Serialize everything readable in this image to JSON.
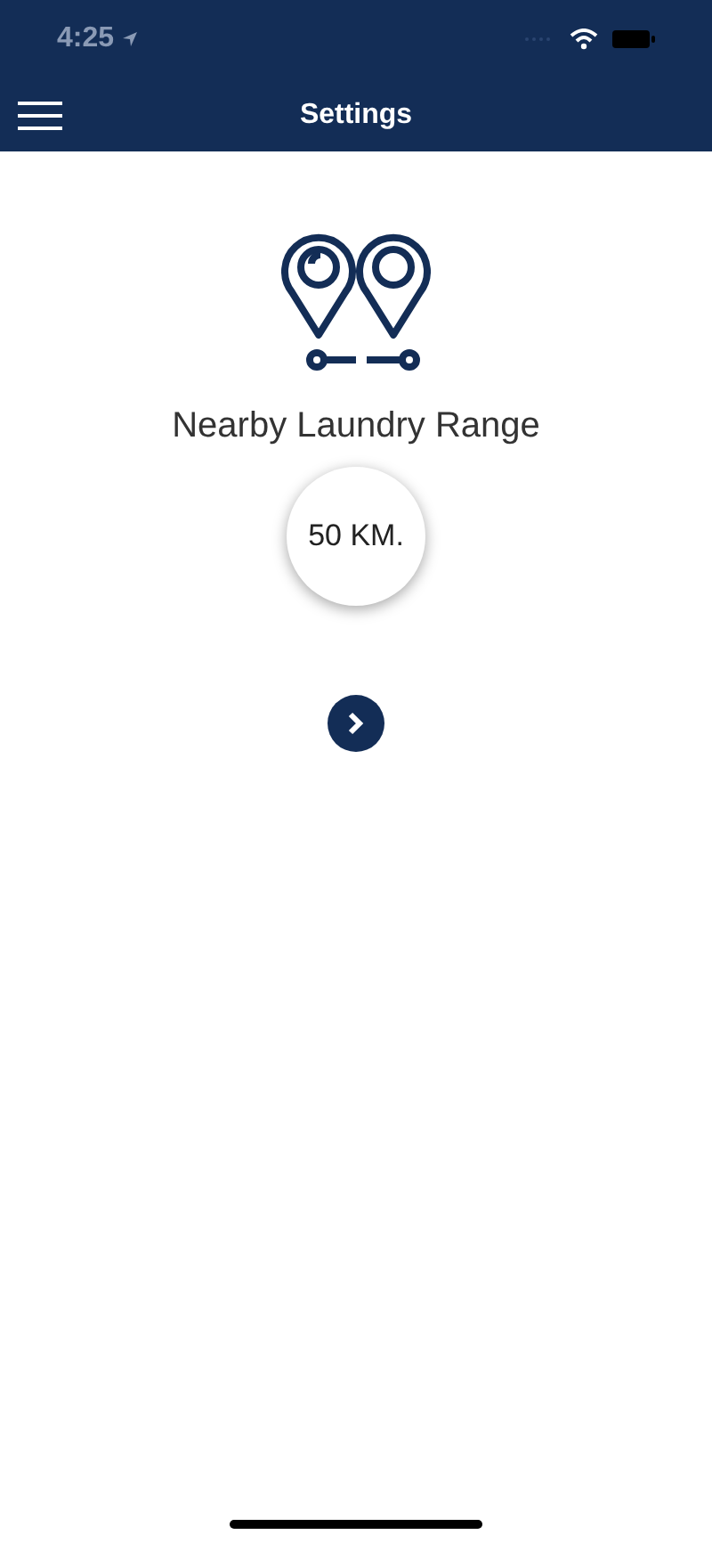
{
  "status_bar": {
    "time": "4:25"
  },
  "nav": {
    "title": "Settings"
  },
  "range": {
    "label": "Nearby Laundry Range",
    "value": "50 KM."
  }
}
